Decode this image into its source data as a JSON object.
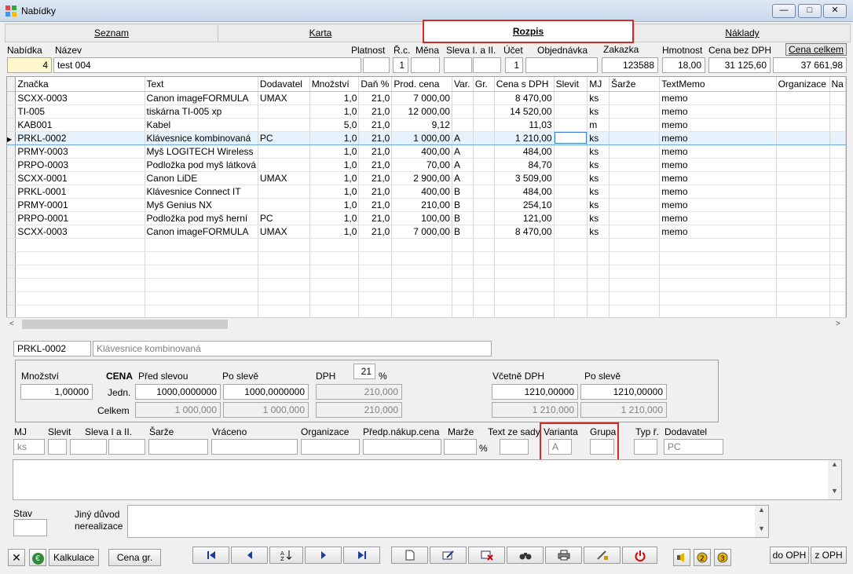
{
  "window": {
    "title": "Nabídky",
    "min": "—",
    "max": "□",
    "close": "✕"
  },
  "tabs": [
    {
      "label": "Seznam"
    },
    {
      "label": "Karta"
    },
    {
      "label": "Rozpis"
    },
    {
      "label": "Náklady"
    }
  ],
  "header": {
    "nabidka_label": "Nabídka",
    "nabidka_value": "4",
    "nazev_label": "Název",
    "nazev_value": "test 004",
    "platnost_label": "Platnost",
    "rc_label": "Ř.c.",
    "rc_value": "1",
    "mena_label": "Měna",
    "sleva_label": "Sleva I. a II.",
    "ucet_label": "Účet",
    "ucet_value": "1",
    "objednavka_label": "Objednávka",
    "zakazka_label": "Zakazka",
    "zakazka_value": "123588",
    "hmotnost_label": "Hmotnost",
    "hmotnost_value": "18,00",
    "cena_bez_label": "Cena bez DPH",
    "cena_bez_value": "31 125,60",
    "cena_celkem_label": "Cena celkem",
    "cena_celkem_value": "37 661,98"
  },
  "grid": {
    "columns": [
      "Značka",
      "Text",
      "Dodavatel",
      "Množství",
      "Daň %",
      "Prod. cena",
      "Var.",
      "Gr.",
      "Cena s DPH",
      "Slevit",
      "MJ",
      "Šarže",
      "TextMemo",
      "Organizace",
      "Na"
    ],
    "rows": [
      [
        "SCXX-0003",
        "Canon imageFORMULA",
        "UMAX",
        "1,0",
        "21,0",
        "7 000,00",
        "",
        "",
        "8 470,00",
        "",
        "ks",
        "",
        "memo",
        "",
        ""
      ],
      [
        "TI-005",
        "tiskárna TI-005 xp",
        "",
        "1,0",
        "21,0",
        "12 000,00",
        "",
        "",
        "14 520,00",
        "",
        "ks",
        "",
        "memo",
        "",
        ""
      ],
      [
        "KAB001",
        "Kabel",
        "",
        "5,0",
        "21,0",
        "9,12",
        "",
        "",
        "11,03",
        "",
        "m",
        "",
        "memo",
        "",
        ""
      ],
      [
        "PRKL-0002",
        "Klávesnice kombinovaná",
        "PC",
        "1,0",
        "21,0",
        "1 000,00",
        "A",
        "",
        "1 210,00",
        "",
        "ks",
        "",
        "memo",
        "",
        ""
      ],
      [
        "PRMY-0003",
        "Myš LOGITECH Wireless",
        "",
        "1,0",
        "21,0",
        "400,00",
        "A",
        "",
        "484,00",
        "",
        "ks",
        "",
        "memo",
        "",
        ""
      ],
      [
        "PRPO-0003",
        "Podložka pod myš látková",
        "",
        "1,0",
        "21,0",
        "70,00",
        "A",
        "",
        "84,70",
        "",
        "ks",
        "",
        "memo",
        "",
        ""
      ],
      [
        "SCXX-0001",
        "Canon LiDE",
        "UMAX",
        "1,0",
        "21,0",
        "2 900,00",
        "A",
        "",
        "3 509,00",
        "",
        "ks",
        "",
        "memo",
        "",
        ""
      ],
      [
        "PRKL-0001",
        "Klávesnice Connect IT",
        "",
        "1,0",
        "21,0",
        "400,00",
        "B",
        "",
        "484,00",
        "",
        "ks",
        "",
        "memo",
        "",
        ""
      ],
      [
        "PRMY-0001",
        "Myš Genius NX",
        "",
        "1,0",
        "21,0",
        "210,00",
        "B",
        "",
        "254,10",
        "",
        "ks",
        "",
        "memo",
        "",
        ""
      ],
      [
        "PRPO-0001",
        "Podložka pod myš herní",
        "PC",
        "1,0",
        "21,0",
        "100,00",
        "B",
        "",
        "121,00",
        "",
        "ks",
        "",
        "memo",
        "",
        ""
      ],
      [
        "SCXX-0003",
        "Canon imageFORMULA",
        "UMAX",
        "1,0",
        "21,0",
        "7 000,00",
        "B",
        "",
        "8 470,00",
        "",
        "ks",
        "",
        "memo",
        "",
        ""
      ]
    ],
    "selected_row": 3
  },
  "detail": {
    "code": "PRKL-0002",
    "name": "Klávesnice kombinovaná",
    "mnozstvi_label": "Množství",
    "mnozstvi_value": "1,00000",
    "cena_label": "CENA",
    "pred_slevou_label": "Před slevou",
    "po_sleve_label": "Po slevě",
    "jedn_label": "Jedn.",
    "celkem_label": "Celkem",
    "jedn_pred": "1000,0000000",
    "jedn_po": "1000,0000000",
    "celkem_pred": "1 000,000",
    "celkem_po": "1 000,000",
    "dph_label": "DPH",
    "dph_rate": "21",
    "pct": "%",
    "dph_jedn": "210,000",
    "dph_celkem": "210,000",
    "vcetne_label": "Včetně DPH",
    "vcetne_po_label": "Po slevě",
    "vc_jedn": "1210,00000",
    "vc_jedn_po": "1210,00000",
    "vc_celkem": "1 210,000",
    "vc_celkem_po": "1 210,000",
    "mj_label": "MJ",
    "mj_value": "ks",
    "slevit_label": "Slevit",
    "sleva_label": "Sleva I a II.",
    "sarze_label": "Šarže",
    "vraceno_label": "Vráceno",
    "organizace_label": "Organizace",
    "predp_label": "Předp.nákup.cena",
    "marze_label": "Marže",
    "marze_pct": "%",
    "text_ze_sady_label": "Text ze sady",
    "varianta_label": "Varianta",
    "varianta_value": "A",
    "grupa_label": "Grupa",
    "typr_label": "Typ ř.",
    "dodavatel_label": "Dodavatel",
    "dodavatel_value": "PC",
    "stav_label": "Stav",
    "jiny_duvod_label1": "Jiný důvod",
    "jiny_duvod_label2": "nerealizace"
  },
  "toolbar": {
    "kalkulace": "Kalkulace",
    "cena_gr": "Cena gr.",
    "do_oph": "do OPH",
    "z_oph": "z OPH",
    "euro": "€",
    "cancel": "✕"
  },
  "colors": {
    "highlight": "#d32a2a",
    "selection": "#e5f1fb",
    "yellow_field": "#fff7cc"
  }
}
